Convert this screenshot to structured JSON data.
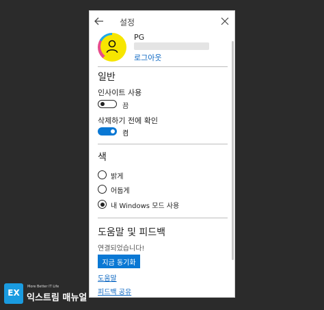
{
  "window": {
    "title": "설정"
  },
  "profile": {
    "name": "PG",
    "signout_label": "로그아웃"
  },
  "general": {
    "heading": "일반",
    "insights": {
      "label": "인사이트 사용",
      "state": "끔",
      "enabled": false
    },
    "delete_confirm": {
      "label": "삭제하기 전에 확인",
      "state": "켬",
      "enabled": true
    }
  },
  "color": {
    "heading": "색",
    "options": [
      {
        "label": "밝게",
        "selected": false
      },
      {
        "label": "어둡게",
        "selected": false
      },
      {
        "label": "내 Windows 모드 사용",
        "selected": true
      }
    ]
  },
  "help": {
    "heading": "도움말 및 피드백",
    "status": "연결되었습니다!",
    "sync_button": "지금 동기화",
    "help_link": "도움말",
    "feedback_link": "피드백 공유"
  },
  "watermark": {
    "logo_mark": "EX",
    "tagline": "More Better IT Life",
    "name": "익스트림 매뉴얼"
  },
  "colors": {
    "accent": "#0a78d4",
    "link": "#0a66c2",
    "background": "#2b2b2b"
  }
}
